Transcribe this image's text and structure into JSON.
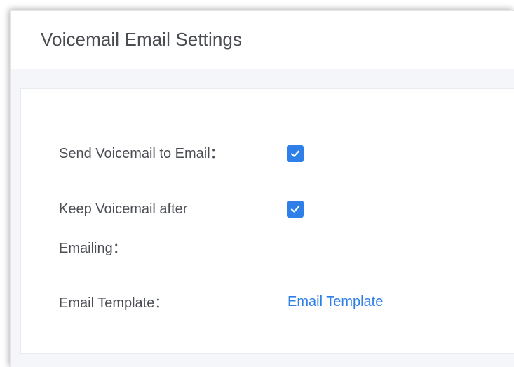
{
  "header": {
    "title": "Voicemail Email Settings"
  },
  "form": {
    "send_voicemail_label": "Send Voicemail to Email：",
    "send_voicemail_checked": true,
    "keep_voicemail_label_line1": "Keep Voicemail after",
    "keep_voicemail_label_line2": "Emailing：",
    "keep_voicemail_checked": true,
    "email_template_label": "Email Template：",
    "email_template_link": "Email Template"
  },
  "colors": {
    "accent": "#2f7fe8",
    "text": "#4b4f55",
    "background": "#f4f6f9"
  },
  "icons": {
    "checkbox_mark": "check-icon"
  }
}
